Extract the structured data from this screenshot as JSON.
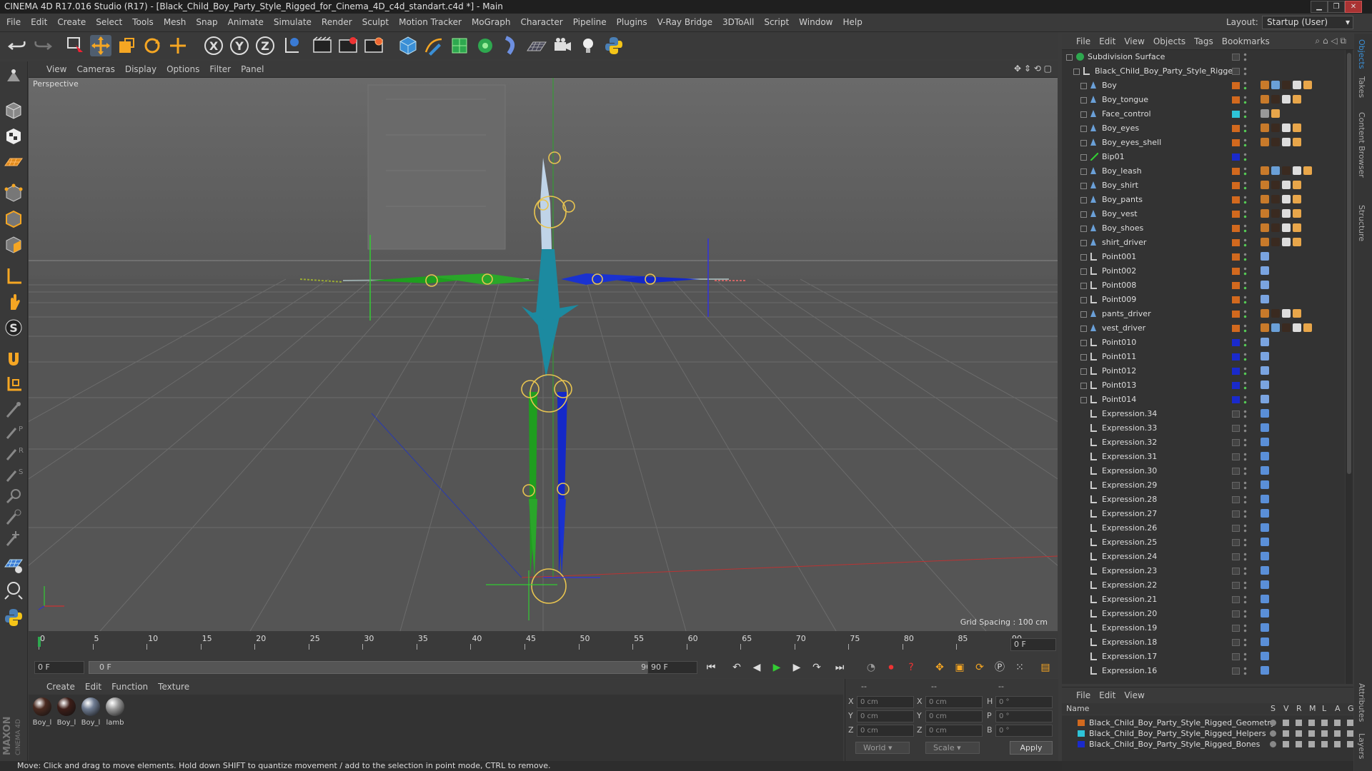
{
  "title": "CINEMA 4D R17.016 Studio (R17) - [Black_Child_Boy_Party_Style_Rigged_for_Cinema_4D_c4d_standart.c4d *] - Main",
  "menu": [
    "File",
    "Edit",
    "Create",
    "Select",
    "Tools",
    "Mesh",
    "Snap",
    "Animate",
    "Simulate",
    "Render",
    "Sculpt",
    "Motion Tracker",
    "MoGraph",
    "Character",
    "Pipeline",
    "Plugins",
    "V-Ray Bridge",
    "3DToAll",
    "Script",
    "Window",
    "Help"
  ],
  "layout": {
    "label": "Layout:",
    "value": "Startup (User)"
  },
  "viewport": {
    "menu": [
      "View",
      "Cameras",
      "Display",
      "Options",
      "Filter",
      "Panel"
    ],
    "label": "Perspective",
    "grid_spacing": "Grid Spacing : 100 cm"
  },
  "timeline": {
    "ticks": [
      "0",
      "5",
      "10",
      "15",
      "20",
      "25",
      "30",
      "35",
      "40",
      "45",
      "50",
      "55",
      "60",
      "65",
      "70",
      "75",
      "80",
      "85",
      "90"
    ],
    "end_frame": "0 F",
    "start_field": "0 F",
    "range_left": "0 F",
    "range_right": "90 F",
    "end_field": "90 F"
  },
  "materials": {
    "menu": [
      "Create",
      "Edit",
      "Function",
      "Texture"
    ],
    "items": [
      {
        "label": "Boy_l",
        "color": "#4a2a20"
      },
      {
        "label": "Boy_l",
        "color": "#3d1e18"
      },
      {
        "label": "Boy_l",
        "color": "#6f7c92"
      },
      {
        "label": "lamb",
        "color": "#9a9a9a"
      }
    ]
  },
  "coords": {
    "header_left": "--",
    "header_mid": "--",
    "header_right": "--",
    "rows": [
      {
        "a": "X",
        "av": "0 cm",
        "b": "X",
        "bv": "0 cm",
        "c": "H",
        "cv": "0 °"
      },
      {
        "a": "Y",
        "av": "0 cm",
        "b": "Y",
        "bv": "0 cm",
        "c": "P",
        "cv": "0 °"
      },
      {
        "a": "Z",
        "av": "0 cm",
        "b": "Z",
        "bv": "0 cm",
        "c": "B",
        "cv": "0 °"
      }
    ],
    "world": "World",
    "scale": "Scale",
    "apply": "Apply"
  },
  "status": "Move: Click and drag to move elements. Hold down SHIFT to quantize movement / add to the selection in point mode, CTRL to remove.",
  "object_manager": {
    "menu": [
      "File",
      "Edit",
      "View",
      "Objects",
      "Tags",
      "Bookmarks"
    ],
    "objects": [
      {
        "name": "Subdivision Surface",
        "level": 0,
        "icon": "subdiv",
        "layer": "",
        "tags": "none"
      },
      {
        "name": "Black_Child_Boy_Party_Style_Rigged",
        "level": 1,
        "icon": "null",
        "layer": "",
        "tags": "none"
      },
      {
        "name": "Boy",
        "level": 2,
        "icon": "bone",
        "layer": "#d2691e",
        "tags": "geo5"
      },
      {
        "name": "Boy_tongue",
        "level": 2,
        "icon": "bone",
        "layer": "#d2691e",
        "tags": "geo4"
      },
      {
        "name": "Face_control",
        "level": 2,
        "icon": "bone",
        "layer": "#2ec4d8",
        "tags": "face"
      },
      {
        "name": "Boy_eyes",
        "level": 2,
        "icon": "bone",
        "layer": "#d2691e",
        "tags": "geo4"
      },
      {
        "name": "Boy_eyes_shell",
        "level": 2,
        "icon": "bone",
        "layer": "#d2691e",
        "tags": "geo4"
      },
      {
        "name": "Bip01",
        "level": 2,
        "icon": "bip",
        "layer": "#1a2acc",
        "tags": "none"
      },
      {
        "name": "Boy_leash",
        "level": 2,
        "icon": "bone",
        "layer": "#d2691e",
        "tags": "geo5"
      },
      {
        "name": "Boy_shirt",
        "level": 2,
        "icon": "bone",
        "layer": "#d2691e",
        "tags": "geo4"
      },
      {
        "name": "Boy_pants",
        "level": 2,
        "icon": "bone",
        "layer": "#d2691e",
        "tags": "geo4"
      },
      {
        "name": "Boy_vest",
        "level": 2,
        "icon": "bone",
        "layer": "#d2691e",
        "tags": "geo4"
      },
      {
        "name": "Boy_shoes",
        "level": 2,
        "icon": "bone",
        "layer": "#d2691e",
        "tags": "geo4"
      },
      {
        "name": "shirt_driver",
        "level": 2,
        "icon": "bone",
        "layer": "#d2691e",
        "tags": "geo4"
      },
      {
        "name": "Point001",
        "level": 2,
        "icon": "null",
        "layer": "#d2691e",
        "tags": "pt"
      },
      {
        "name": "Point002",
        "level": 2,
        "icon": "null",
        "layer": "#d2691e",
        "tags": "pt"
      },
      {
        "name": "Point008",
        "level": 2,
        "icon": "null",
        "layer": "#d2691e",
        "tags": "pt"
      },
      {
        "name": "Point009",
        "level": 2,
        "icon": "null",
        "layer": "#d2691e",
        "tags": "pt"
      },
      {
        "name": "pants_driver",
        "level": 2,
        "icon": "bone",
        "layer": "#d2691e",
        "tags": "geo4"
      },
      {
        "name": "vest_driver",
        "level": 2,
        "icon": "bone",
        "layer": "#d2691e",
        "tags": "geo5"
      },
      {
        "name": "Point010",
        "level": 2,
        "icon": "null",
        "layer": "#1a2acc",
        "tags": "pt"
      },
      {
        "name": "Point011",
        "level": 2,
        "icon": "null",
        "layer": "#1a2acc",
        "tags": "pt"
      },
      {
        "name": "Point012",
        "level": 2,
        "icon": "null",
        "layer": "#1a2acc",
        "tags": "pt"
      },
      {
        "name": "Point013",
        "level": 2,
        "icon": "null",
        "layer": "#1a2acc",
        "tags": "pt"
      },
      {
        "name": "Point014",
        "level": 2,
        "icon": "null",
        "layer": "#1a2acc",
        "tags": "pt"
      },
      {
        "name": "Expression.34",
        "level": 2,
        "icon": "null",
        "layer": "",
        "tags": "xp"
      },
      {
        "name": "Expression.33",
        "level": 2,
        "icon": "null",
        "layer": "",
        "tags": "xp"
      },
      {
        "name": "Expression.32",
        "level": 2,
        "icon": "null",
        "layer": "",
        "tags": "xp"
      },
      {
        "name": "Expression.31",
        "level": 2,
        "icon": "null",
        "layer": "",
        "tags": "xp"
      },
      {
        "name": "Expression.30",
        "level": 2,
        "icon": "null",
        "layer": "",
        "tags": "xp"
      },
      {
        "name": "Expression.29",
        "level": 2,
        "icon": "null",
        "layer": "",
        "tags": "xp"
      },
      {
        "name": "Expression.28",
        "level": 2,
        "icon": "null",
        "layer": "",
        "tags": "xp"
      },
      {
        "name": "Expression.27",
        "level": 2,
        "icon": "null",
        "layer": "",
        "tags": "xp"
      },
      {
        "name": "Expression.26",
        "level": 2,
        "icon": "null",
        "layer": "",
        "tags": "xp"
      },
      {
        "name": "Expression.25",
        "level": 2,
        "icon": "null",
        "layer": "",
        "tags": "xp"
      },
      {
        "name": "Expression.24",
        "level": 2,
        "icon": "null",
        "layer": "",
        "tags": "xp"
      },
      {
        "name": "Expression.23",
        "level": 2,
        "icon": "null",
        "layer": "",
        "tags": "xp"
      },
      {
        "name": "Expression.22",
        "level": 2,
        "icon": "null",
        "layer": "",
        "tags": "xp"
      },
      {
        "name": "Expression.21",
        "level": 2,
        "icon": "null",
        "layer": "",
        "tags": "xp"
      },
      {
        "name": "Expression.20",
        "level": 2,
        "icon": "null",
        "layer": "",
        "tags": "xp"
      },
      {
        "name": "Expression.19",
        "level": 2,
        "icon": "null",
        "layer": "",
        "tags": "xp"
      },
      {
        "name": "Expression.18",
        "level": 2,
        "icon": "null",
        "layer": "",
        "tags": "xp"
      },
      {
        "name": "Expression.17",
        "level": 2,
        "icon": "null",
        "layer": "",
        "tags": "xp"
      },
      {
        "name": "Expression.16",
        "level": 2,
        "icon": "null",
        "layer": "",
        "tags": "xp"
      }
    ]
  },
  "layer_manager": {
    "menu": [
      "File",
      "Edit",
      "View"
    ],
    "header": {
      "name": "Name",
      "cols": [
        "S",
        "V",
        "R",
        "M",
        "L",
        "A",
        "G"
      ]
    },
    "layers": [
      {
        "name": "Black_Child_Boy_Party_Style_Rigged_Geometry",
        "color": "#d2691e"
      },
      {
        "name": "Black_Child_Boy_Party_Style_Rigged_Helpers",
        "color": "#2ec4d8"
      },
      {
        "name": "Black_Child_Boy_Party_Style_Rigged_Bones",
        "color": "#1a2acc"
      }
    ]
  },
  "right_tabs": [
    "Objects",
    "Takes",
    "Content Browser",
    "Structure",
    "Attributes",
    "Layers"
  ],
  "colors": {
    "accent": "#3a8fd6",
    "bone_green": "#1f9e1f",
    "bone_blue": "#1428c8",
    "bone_teal": "#1c8aa0",
    "viewport_bg": "#5e5e5e"
  }
}
